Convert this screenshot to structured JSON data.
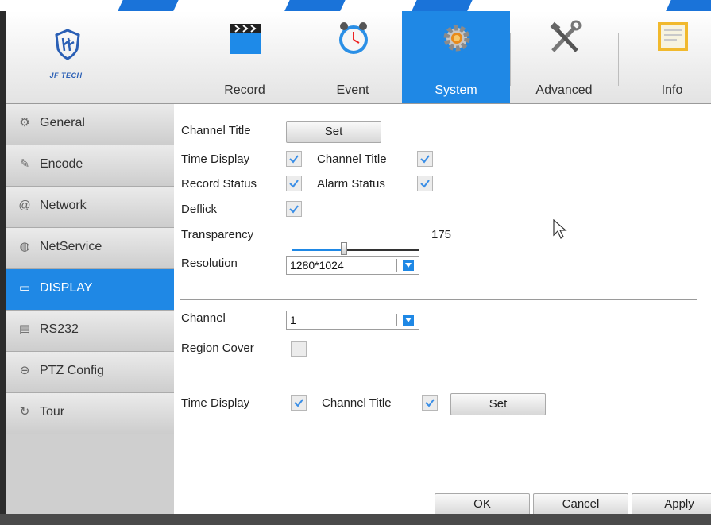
{
  "logo": {
    "brand": "JF TECH"
  },
  "nav": {
    "tabs": [
      {
        "label": "Record",
        "icon": "clapperboard-icon"
      },
      {
        "label": "Event",
        "icon": "alarm-clock-icon"
      },
      {
        "label": "System",
        "icon": "gear-icon"
      },
      {
        "label": "Advanced",
        "icon": "tools-icon"
      },
      {
        "label": "Info",
        "icon": "monitor-info-icon"
      }
    ],
    "active": "System"
  },
  "sidebar": {
    "items": [
      {
        "label": "General",
        "icon": "gear-icon"
      },
      {
        "label": "Encode",
        "icon": "edit-icon"
      },
      {
        "label": "Network",
        "icon": "at-icon"
      },
      {
        "label": "NetService",
        "icon": "globe-icon"
      },
      {
        "label": "DISPLAY",
        "icon": "monitor-icon"
      },
      {
        "label": "RS232",
        "icon": "serial-port-icon"
      },
      {
        "label": "PTZ Config",
        "icon": "camera-dome-icon"
      },
      {
        "label": "Tour",
        "icon": "refresh-icon"
      }
    ],
    "active": "DISPLAY"
  },
  "display": {
    "channel_title_label": "Channel Title",
    "set_label": "Set",
    "time_display_label": "Time Display",
    "time_display_checked": true,
    "channel_title_checkbox_label": "Channel Title",
    "channel_title_checked": true,
    "record_status_label": "Record Status",
    "record_status_checked": true,
    "alarm_status_label": "Alarm Status",
    "alarm_status_checked": true,
    "deflick_label": "Deflick",
    "deflick_checked": true,
    "transparency_label": "Transparency",
    "transparency_value": "175",
    "transparency_level": 175,
    "transparency_max": 255,
    "resolution_label": "Resolution",
    "resolution_value": "1280*1024",
    "channel_label": "Channel",
    "channel_value": "1",
    "region_cover_label": "Region Cover",
    "region_cover_checked": false,
    "time_display2_label": "Time Display",
    "time_display2_checked": true,
    "channel_title2_label": "Channel Title",
    "channel_title2_checked": true,
    "set2_label": "Set"
  },
  "actions": {
    "ok": "OK",
    "cancel": "Cancel",
    "apply": "Apply"
  },
  "colors": {
    "accent": "#1f88e5",
    "check": "#3a8ee6"
  }
}
